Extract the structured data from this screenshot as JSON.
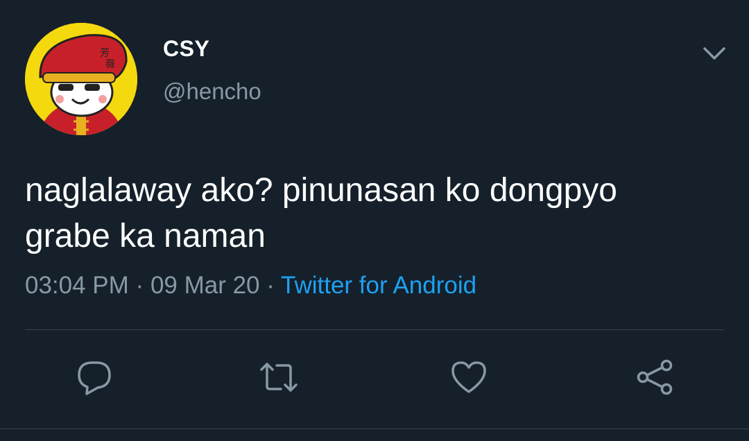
{
  "user": {
    "display_name": "CSY",
    "handle": "@hencho",
    "avatar_icon": "cartoon-character-avatar"
  },
  "tweet": {
    "lines": [
      "naglalaway ako? pinunasan ko dongpyo",
      "grabe ka naman"
    ],
    "time": "03:04 PM",
    "separator": "·",
    "date": "09 Mar 20",
    "source": "Twitter for Android"
  },
  "actions": {
    "reply_icon": "speech-bubble-icon",
    "retweet_icon": "retweet-icon",
    "like_icon": "heart-icon",
    "share_icon": "share-icon"
  },
  "colors": {
    "background": "#15202b",
    "text_primary": "#ffffff",
    "text_secondary": "#8899a6",
    "link": "#1da1f2",
    "divider": "#38444d"
  }
}
